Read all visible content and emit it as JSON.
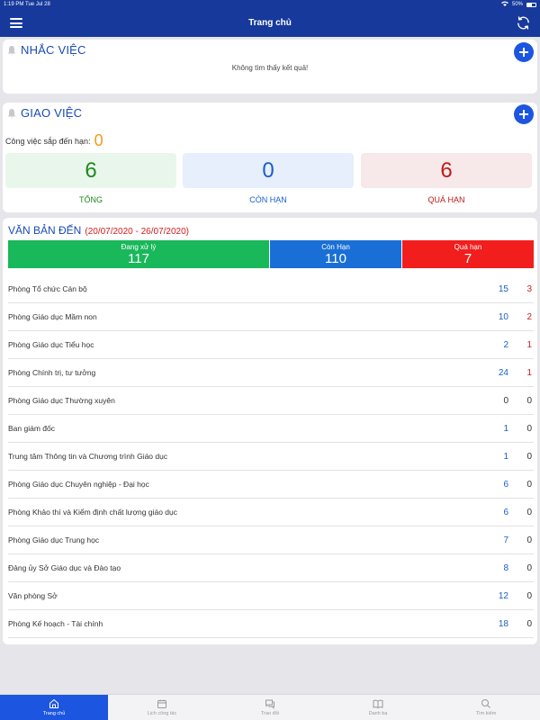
{
  "status": {
    "time": "1:19 PM",
    "date": "Tue Jul 28",
    "battery": "50%"
  },
  "nav": {
    "title": "Trang chủ"
  },
  "reminders": {
    "title": "NHẮC VIỆC",
    "empty_text": "Không tìm thấy kết quả!"
  },
  "tasks": {
    "title": "GIAO VIỆC",
    "upcoming_label": "Công việc sắp đến hạn:",
    "upcoming_count": "0",
    "stats": [
      {
        "value": "6",
        "label": "TỔNG",
        "color": "#1f8a1f",
        "bg": "#e9f6ec"
      },
      {
        "value": "0",
        "label": "CÒN HẠN",
        "color": "#1a5fc9",
        "bg": "#e7eefc"
      },
      {
        "value": "6",
        "label": "QUÁ HẠN",
        "color": "#c21a1a",
        "bg": "#f7e9e9"
      }
    ]
  },
  "documents": {
    "title": "VĂN BẢN ĐẾN",
    "date_range": "(20/07/2020 - 26/07/2020)",
    "summary": [
      {
        "label": "Đang xử lý",
        "value": "117",
        "color": "#19b85a"
      },
      {
        "label": "Còn Hạn",
        "value": "110",
        "color": "#1a6fd6"
      },
      {
        "label": "Quá hạn",
        "value": "7",
        "color": "#f21d1d"
      }
    ],
    "rows": [
      {
        "name": "Phòng Tổ chức Cán bộ",
        "a": "15",
        "b": "3"
      },
      {
        "name": "Phòng Giáo dục Mầm non",
        "a": "10",
        "b": "2"
      },
      {
        "name": "Phòng Giáo dục Tiểu học",
        "a": "2",
        "b": "1"
      },
      {
        "name": "Phòng Chính trị, tư tưởng",
        "a": "24",
        "b": "1"
      },
      {
        "name": "Phòng Giáo dục Thường xuyên",
        "a": "0",
        "b": "0"
      },
      {
        "name": "Ban giám đốc",
        "a": "1",
        "b": "0"
      },
      {
        "name": "Trung tâm Thông tin và Chương trình Giáo dục",
        "a": "1",
        "b": "0"
      },
      {
        "name": "Phòng Giáo dục Chuyên nghiệp - Đại học",
        "a": "6",
        "b": "0"
      },
      {
        "name": "Phòng Khảo thí và Kiểm định chất lượng giáo dục",
        "a": "6",
        "b": "0"
      },
      {
        "name": "Phòng Giáo dục Trung học",
        "a": "7",
        "b": "0"
      },
      {
        "name": "Đảng ủy Sở Giáo dục và Đào tạo",
        "a": "8",
        "b": "0"
      },
      {
        "name": "Văn phòng Sở",
        "a": "12",
        "b": "0"
      },
      {
        "name": "Phòng Kế hoạch - Tài chính",
        "a": "18",
        "b": "0"
      }
    ]
  },
  "tabs": [
    {
      "label": "Trang chủ",
      "icon": "home-icon"
    },
    {
      "label": "Lịch công tác",
      "icon": "calendar-icon"
    },
    {
      "label": "Trao đổi",
      "icon": "chat-icon"
    },
    {
      "label": "Danh bạ",
      "icon": "book-icon"
    },
    {
      "label": "Tìm kiếm",
      "icon": "search-icon"
    }
  ]
}
